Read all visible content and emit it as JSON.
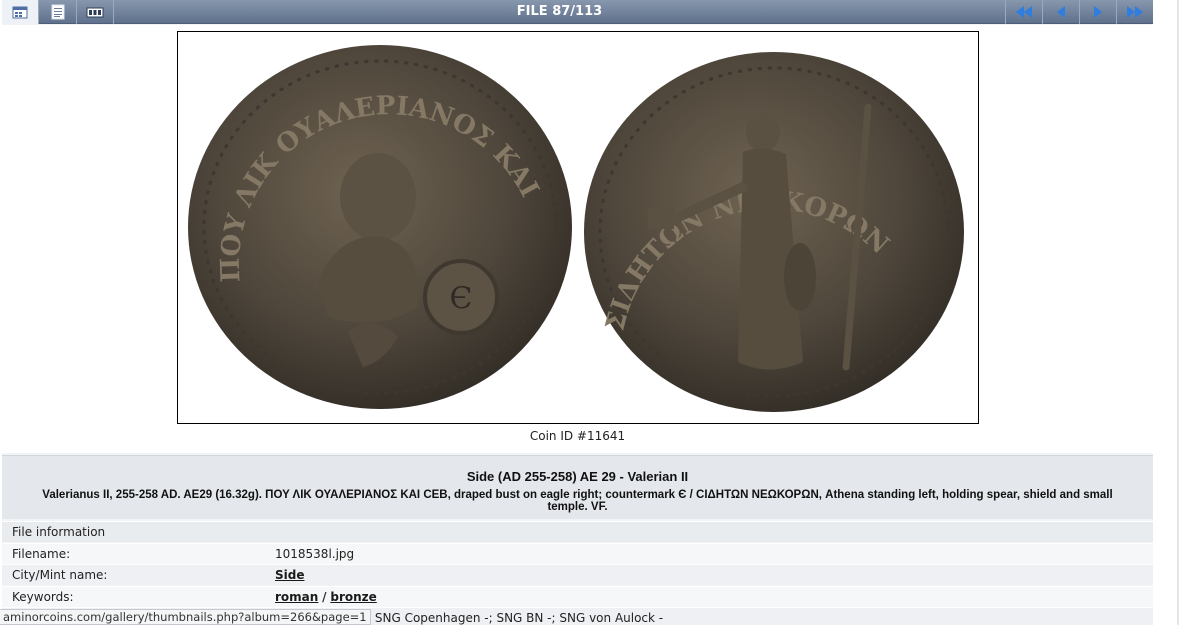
{
  "navbar": {
    "title": "FILE 87/113",
    "left_buttons": [
      {
        "icon": "thumbnails-icon"
      },
      {
        "icon": "file-info-icon"
      },
      {
        "icon": "slideshow-icon"
      }
    ],
    "right_buttons": [
      {
        "icon": "first-file-icon"
      },
      {
        "icon": "previous-file-icon"
      },
      {
        "icon": "next-file-icon"
      },
      {
        "icon": "last-file-icon"
      }
    ],
    "colors": {
      "bar": "#6f819c",
      "arrows": "#2f7de1"
    }
  },
  "image": {
    "caption": "Coin ID #11641",
    "obverse_legend": "ΠΟΥ ΛΙΚ ΟΥΑΛΕΡΙΑΝΟΣ ΚΑΙ ΣΕΒ",
    "reverse_legend": "ΣΙΔΗΤΩΝ ΝΕΩΚΟΡΩΝ"
  },
  "description": {
    "title": "Side (AD 255-258) AE 29 - Valerian II",
    "text": "Valerianus II, 255-258 AD. AE29 (16.32g). ΠΟΥ ΛΙΚ ΟΥΑΛΕΡΙΑΝΟΣ ΚΑΙ CΕΒ, draped bust on eagle right; countermark Є / CΙΔΗΤΩΝ ΝΕΩΚΟΡΩΝ, Athena standing left, holding spear, shield and small temple. VF."
  },
  "info": {
    "header": "File information",
    "rows": [
      {
        "label": "Filename:",
        "value": "1018538l.jpg"
      },
      {
        "label": "City/Mint name:",
        "value": "Side"
      },
      {
        "label": "Keywords:",
        "links": [
          "roman",
          "bronze"
        ],
        "separator": "/"
      },
      {
        "label": "",
        "value": "PS -; SNG Copenhagen -; SNG BN -; SNG von Aulock -"
      }
    ]
  },
  "statusbar": {
    "url": "aminorcoins.com/gallery/thumbnails.php?album=266&page=1"
  }
}
